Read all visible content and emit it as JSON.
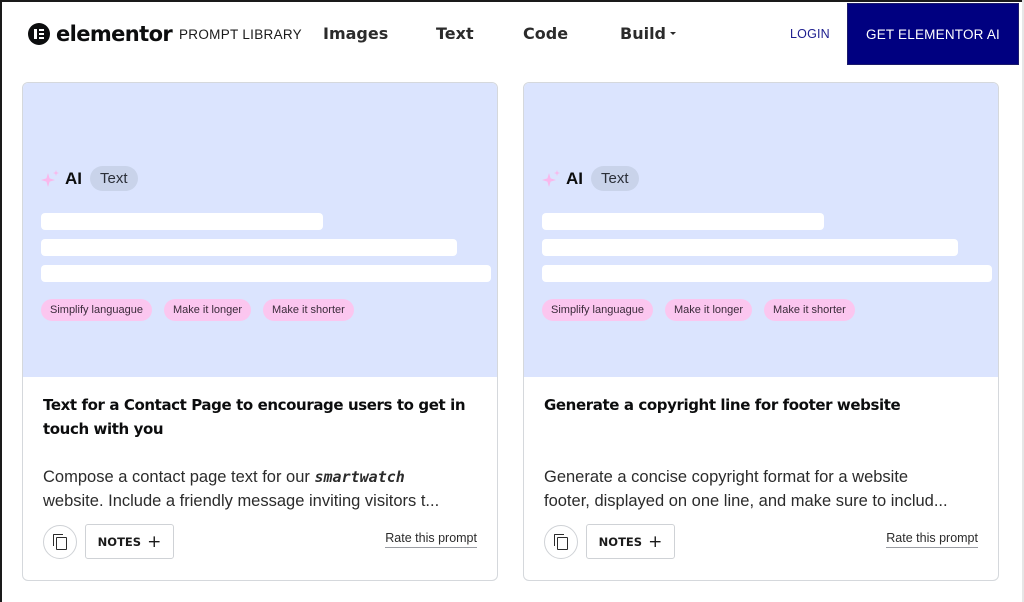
{
  "header": {
    "brand": "elementor",
    "section_label": "PROMPT LIBRARY",
    "nav": [
      {
        "label": "Images"
      },
      {
        "label": "Text"
      },
      {
        "label": "Code"
      },
      {
        "label": "Build",
        "has_dropdown": true
      }
    ],
    "login_label": "LOGIN",
    "cta_label": "GET ELEMENTOR AI"
  },
  "colors": {
    "cta_bg": "#000080",
    "preview_bg": "#dbe4fe",
    "chip_bg": "#fbc6ef",
    "type_chip_bg": "#c9d3ea",
    "login_text": "#1d1e8f"
  },
  "cards": [
    {
      "preview": {
        "ai_label": "AI",
        "type_chip": "Text",
        "chips": [
          "Simplify languague",
          "Make it longer",
          "Make it shorter"
        ]
      },
      "title": "Text for a Contact Page to encourage users to get in touch with you",
      "description": {
        "line1_prefix": "Compose a contact page text for our ",
        "line1_code": "smartwatch",
        "line2": "website. Include a friendly message inviting visitors t..."
      },
      "notes_label": "NOTES",
      "rate_label": "Rate this prompt"
    },
    {
      "preview": {
        "ai_label": "AI",
        "type_chip": "Text",
        "chips": [
          "Simplify languague",
          "Make it longer",
          "Make it shorter"
        ]
      },
      "title": "Generate a copyright line for footer website",
      "description": {
        "line1_prefix": "Generate a concise copyright format for a website",
        "line1_code": "",
        "line2": "footer, displayed on one line, and make sure to includ..."
      },
      "notes_label": "NOTES",
      "rate_label": "Rate this prompt"
    }
  ]
}
